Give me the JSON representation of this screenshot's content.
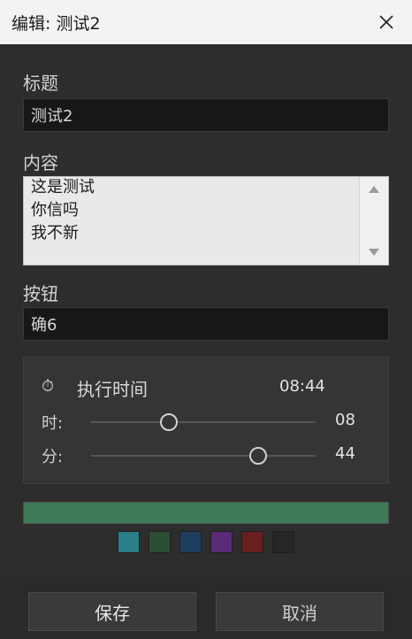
{
  "window": {
    "title": "编辑: 测试2"
  },
  "fields": {
    "title": {
      "label": "标题",
      "value": "测试2"
    },
    "content": {
      "label": "内容",
      "lines": [
        "这是测试",
        "你信吗",
        "我不新"
      ]
    },
    "button": {
      "label": "按钮",
      "value": "确6"
    }
  },
  "time": {
    "icon": "stopwatch-icon",
    "label": "执行时间",
    "value": "08:44",
    "hour": {
      "label": "时:",
      "value": "08",
      "level": 0.348
    },
    "minute": {
      "label": "分:",
      "value": "44",
      "level": 0.746
    }
  },
  "color": {
    "selected": "#3c7a58",
    "swatches": [
      "#2a7f8a",
      "#2b4f34",
      "#1f3e5e",
      "#5b2b7a",
      "#6a1f1f",
      "#262626"
    ]
  },
  "footer": {
    "save_label": "保存",
    "cancel_label": "取消"
  }
}
